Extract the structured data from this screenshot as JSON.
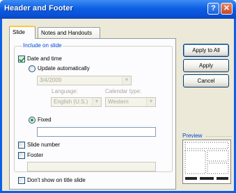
{
  "window": {
    "title": "Header and Footer"
  },
  "tabs": [
    {
      "label": "Slide",
      "active": true
    },
    {
      "label": "Notes and Handouts",
      "active": false
    }
  ],
  "include_group": {
    "label": "Include on slide",
    "date_and_time": {
      "label": "Date and time",
      "checked": true
    },
    "update_automatically": {
      "label": "Update automatically",
      "selected": false,
      "date_value": "3/4/2009"
    },
    "language": {
      "label": "Language:",
      "value": "English (U.S.)"
    },
    "calendar_type": {
      "label": "Calendar type:",
      "value": "Western"
    },
    "fixed": {
      "label": "Fixed",
      "selected": true,
      "value": ""
    },
    "slide_number": {
      "label": "Slide number",
      "checked": false
    },
    "footer": {
      "label": "Footer",
      "checked": false,
      "value": ""
    }
  },
  "dont_show_title": {
    "label": "Don't show on title slide",
    "checked": false
  },
  "buttons": {
    "apply_to_all": "Apply to All",
    "apply": "Apply",
    "cancel": "Cancel"
  },
  "preview": {
    "label": "Preview"
  },
  "colors": {
    "accent": "#0c5fe5",
    "group_label": "#0046d5",
    "dialog_bg": "#ece9d8"
  }
}
